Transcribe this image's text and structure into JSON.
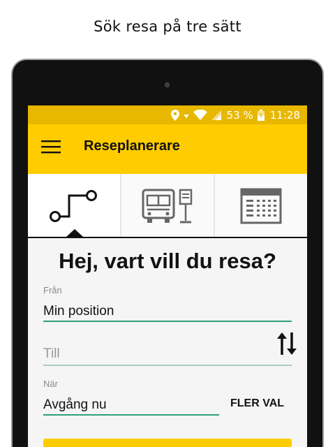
{
  "caption": "Sök resa på tre sätt",
  "status_bar": {
    "battery_percent": "53 %",
    "time": "11:28",
    "icons": [
      "location-icon",
      "wifi-icon",
      "cell-signal-icon",
      "battery-charging-icon"
    ]
  },
  "app_bar": {
    "title": "Reseplanerare",
    "menu_icon": "hamburger-menu-icon"
  },
  "tabs": [
    {
      "icon": "route-icon",
      "selected": true
    },
    {
      "icon": "bus-stop-icon",
      "selected": false
    },
    {
      "icon": "timetable-icon",
      "selected": false
    }
  ],
  "main": {
    "heading": "Hej, vart vill du resa?",
    "from": {
      "label": "Från",
      "value": "Min position"
    },
    "to": {
      "placeholder": "Till"
    },
    "when": {
      "label": "När",
      "value": "Avgång nu"
    },
    "more_options_label": "FLER VAL",
    "swap_icon": "swap-vertical-icon"
  },
  "colors": {
    "primary": "#ffcc00",
    "status_bar": "#e8b800",
    "field_underline": "#2e9e7f",
    "text": "#111111"
  }
}
